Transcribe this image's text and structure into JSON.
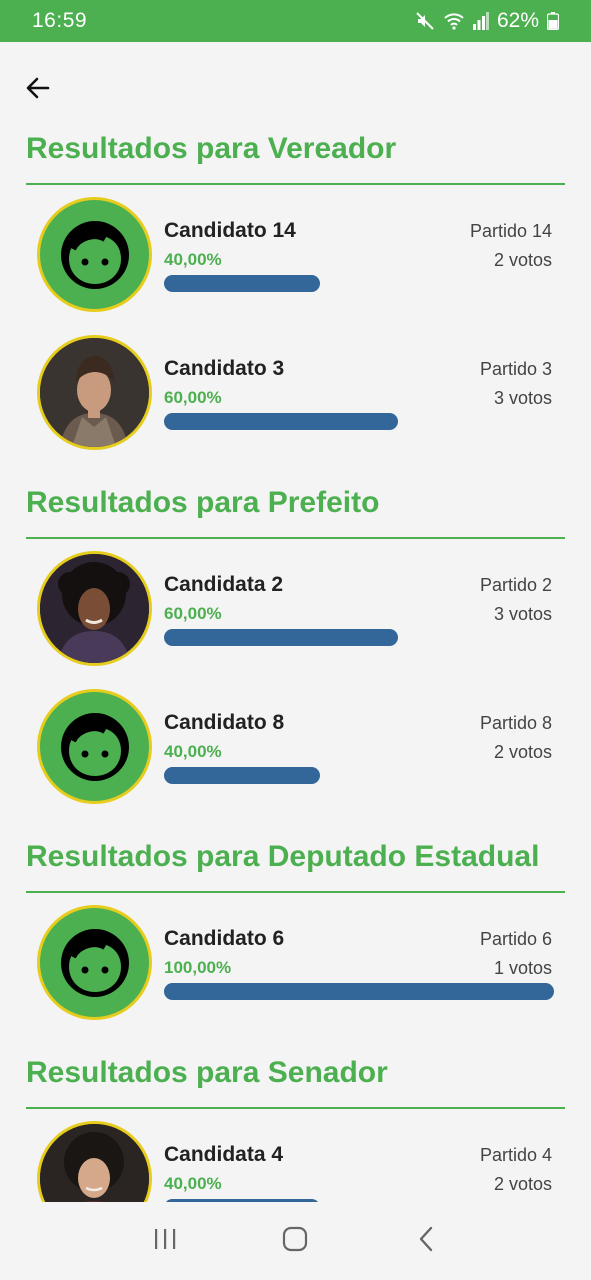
{
  "status_bar": {
    "time": "16:59",
    "battery": "62%",
    "icons": [
      "mute-icon",
      "wifi-icon",
      "signal-icon",
      "battery-icon"
    ]
  },
  "colors": {
    "accent": "#4caf50",
    "bar": "#336699",
    "avatar_border": "#e6cc1c"
  },
  "sections": [
    {
      "title": "Resultados para Vereador",
      "candidates": [
        {
          "name": "Candidato 14",
          "percent": "40,00%",
          "fraction": 0.4,
          "party": "Partido 14",
          "votes": "2 votos",
          "avatar": "default-avatar-icon"
        },
        {
          "name": "Candidato 3",
          "percent": "60,00%",
          "fraction": 0.6,
          "party": "Partido 3",
          "votes": "3 votos",
          "avatar": "photo"
        }
      ]
    },
    {
      "title": "Resultados para Prefeito",
      "candidates": [
        {
          "name": "Candidata 2",
          "percent": "60,00%",
          "fraction": 0.6,
          "party": "Partido 2",
          "votes": "3 votos",
          "avatar": "photo"
        },
        {
          "name": "Candidato 8",
          "percent": "40,00%",
          "fraction": 0.4,
          "party": "Partido 8",
          "votes": "2 votos",
          "avatar": "default-avatar-icon"
        }
      ]
    },
    {
      "title": "Resultados para Deputado Estadual",
      "candidates": [
        {
          "name": "Candidato 6",
          "percent": "100,00%",
          "fraction": 1.0,
          "party": "Partido 6",
          "votes": "1 votos",
          "avatar": "default-avatar-icon"
        }
      ]
    },
    {
      "title": "Resultados para Senador",
      "candidates": [
        {
          "name": "Candidata 4",
          "percent": "40,00%",
          "fraction": 0.4,
          "party": "Partido 4",
          "votes": "2 votos",
          "avatar": "photo"
        }
      ]
    }
  ],
  "nav": [
    "recent-apps-icon",
    "home-icon",
    "back-nav-icon"
  ]
}
